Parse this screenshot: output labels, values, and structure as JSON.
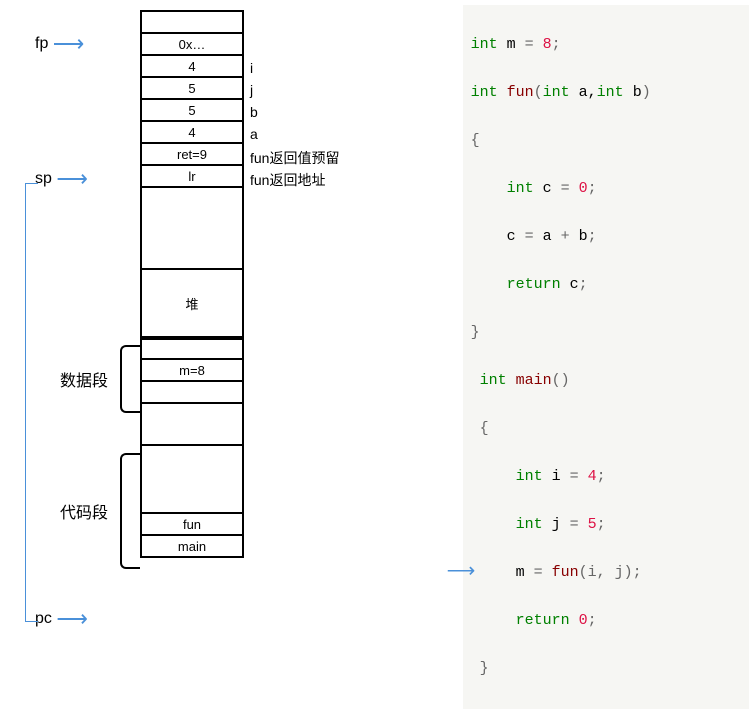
{
  "pointers": {
    "fp": "fp",
    "sp": "sp",
    "pc": "pc"
  },
  "cells": {
    "blank_top": "",
    "ox": "0x…",
    "four1": "4",
    "five1": "5",
    "five2": "5",
    "four2": "4",
    "ret": "ret=9",
    "lr": "lr",
    "heap": "堆",
    "m8": "m=8",
    "fun": "fun",
    "main": "main"
  },
  "rlabels": {
    "i": "i",
    "j": "j",
    "b": "b",
    "a": "a",
    "retd": "fun返回值预留",
    "retaddr": "fun返回地址"
  },
  "segments": {
    "data": "数据段",
    "code": "代码段"
  },
  "source": {
    "l1": {
      "int": "int",
      "sp": " m ",
      "eq": "=",
      "sp2": " ",
      "v": "8",
      "semi": ";"
    },
    "l2": {
      "int": "int",
      "sp": " ",
      "fn": "fun",
      "op": "(",
      "int2": "int",
      "sp2": " a,",
      "int3": "int",
      "sp3": " b",
      ")": ")"
    },
    "l3": "{",
    "l4": {
      "pad": "    ",
      "int": "int",
      "sp": " c ",
      "eq": "=",
      "sp2": " ",
      "v": "0",
      "semi": ";"
    },
    "l5": {
      "pad": "    ",
      "lhs": "c ",
      "eq": "=",
      "rhs": " a ",
      "plus": "+",
      "r2": " b",
      ";": ";"
    },
    "l6": {
      "pad": "    ",
      "ret": "return",
      "sp": " c",
      ";": ";"
    },
    "l7": "}",
    "l8": {
      "sp": " ",
      "int": "int",
      "sp2": " ",
      "fn": "main",
      "p": "()"
    },
    "l9": {
      "sp": " ",
      "b": "{"
    },
    "l10": {
      "pad": "     ",
      "int": "int",
      "sp": " i ",
      "eq": "=",
      "sp2": " ",
      "v": "4",
      ";": ";"
    },
    "l11": {
      "pad": "     ",
      "int": "int",
      "sp": " j ",
      "eq": "=",
      "sp2": " ",
      "v": "5",
      ";": ";"
    },
    "l12": {
      "pad": "     ",
      "lhs": "m ",
      "eq": "=",
      "sp": " ",
      "fn": "fun",
      "args": "(i, j)",
      ";": ";"
    },
    "l13": {
      "pad": "     ",
      "ret": "return",
      "sp": " ",
      "v": "0",
      ";": ";"
    },
    "l14": {
      "sp": " ",
      "b": "}"
    }
  }
}
